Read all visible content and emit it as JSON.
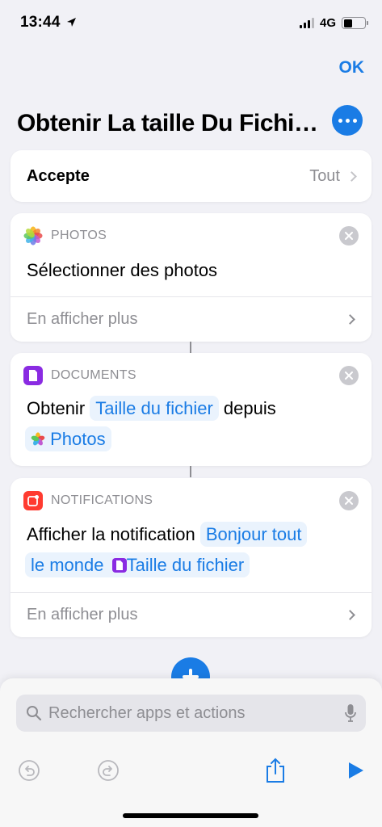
{
  "status_bar": {
    "time": "13:44",
    "network": "4G"
  },
  "header": {
    "done_label": "OK",
    "title": "Obtenir La taille Du Fichi…"
  },
  "accepte": {
    "label": "Accepte",
    "value": "Tout"
  },
  "actions": [
    {
      "app": "PHOTOS",
      "icon": "photos-icon",
      "text": "Sélectionner des photos",
      "more": "En afficher plus"
    },
    {
      "app": "DOCUMENTS",
      "icon": "documents-icon",
      "text_prefix": "Obtenir",
      "token_main": "Taille du fichier",
      "text_mid": "depuis",
      "token_source": "Photos"
    },
    {
      "app": "NOTIFICATIONS",
      "icon": "notifications-icon",
      "text_prefix": "Afficher la notification",
      "token_text_1": "Bonjour tout",
      "token_text_2": "le monde",
      "token_var": "Taille du fichier",
      "more": "En afficher plus"
    }
  ],
  "search": {
    "placeholder": "Rechercher apps et actions"
  },
  "colors": {
    "accent": "#1a7ce5",
    "background": "#f1f1f6",
    "documents": "#8a2be2",
    "notifications": "#ff3b30"
  }
}
